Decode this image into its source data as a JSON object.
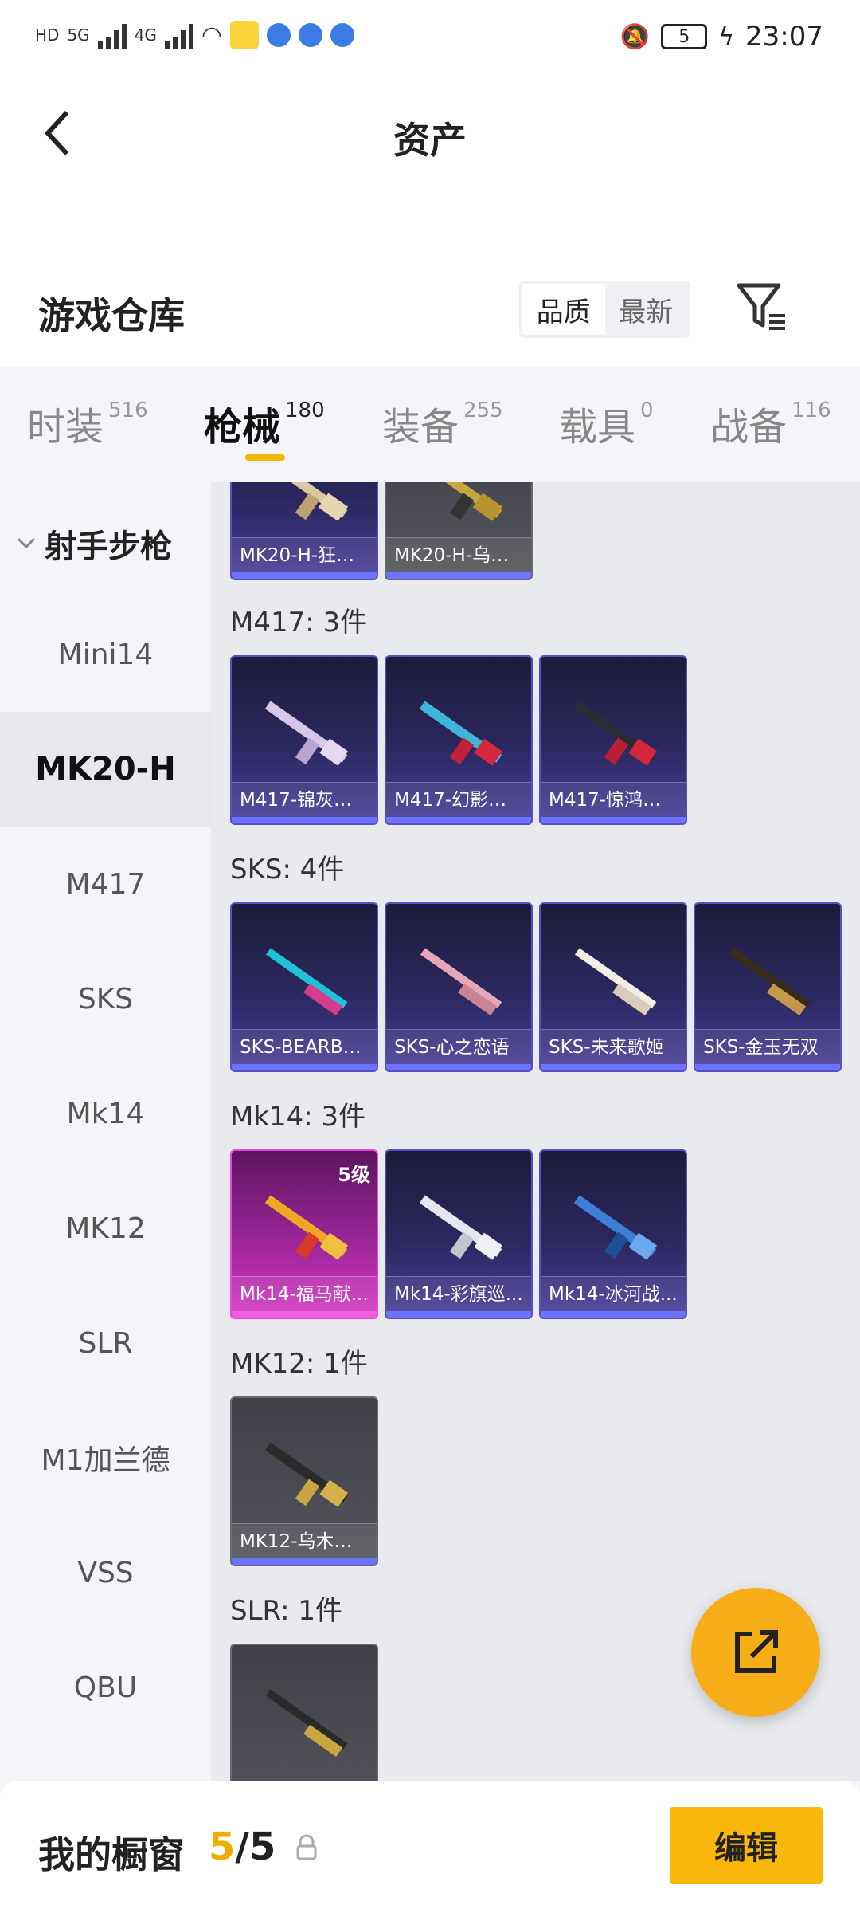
{
  "status_bar": {
    "time": "23:07",
    "battery": "5",
    "left_labels": [
      "HD",
      "5G",
      "4G"
    ]
  },
  "header": {
    "title": "资产"
  },
  "warehouse": {
    "title": "游戏仓库",
    "sort_options": [
      "品质",
      "最新"
    ],
    "active_sort": "品质"
  },
  "tabs": [
    {
      "label": "时装",
      "count": "516"
    },
    {
      "label": "枪械",
      "count": "180"
    },
    {
      "label": "装备",
      "count": "255"
    },
    {
      "label": "载具",
      "count": "0"
    },
    {
      "label": "战备",
      "count": "116"
    }
  ],
  "active_tab": "枪械",
  "sidebar": {
    "group": "射手步枪",
    "items": [
      "Mini14",
      "MK20-H",
      "M417",
      "SKS",
      "Mk14",
      "MK12",
      "SLR",
      "M1加兰德",
      "VSS",
      "QBU"
    ],
    "active_item": "MK20-H"
  },
  "content": {
    "top_partial": [
      "MK20-H-狂鲨...",
      "MK20-H-乌木..."
    ],
    "categories": [
      {
        "title": "M417: 3件",
        "items": [
          "M417-锦灰蝶...",
          "M417-幻影飞...",
          "M417-惊鸿侠..."
        ]
      },
      {
        "title": "SKS: 4件",
        "items": [
          "SKS-BEARBR...",
          "SKS-心之恋语",
          "SKS-未来歌姬",
          "SKS-金玉无双"
        ]
      },
      {
        "title": "Mk14: 3件",
        "items": [
          "Mk14-福马献...",
          "Mk14-彩旗巡...",
          "Mk14-冰河战..."
        ],
        "badge": "5级"
      },
      {
        "title": "MK12: 1件",
        "items": [
          "MK12-乌木金..."
        ]
      },
      {
        "title": "SLR: 1件",
        "items": [
          ""
        ]
      }
    ]
  },
  "bottom_bar": {
    "label": "我的橱窗",
    "current": "5",
    "separator": "/",
    "total": "5",
    "edit_label": "编辑"
  },
  "colors": {
    "accent": "#f5b800",
    "epic_card": "#4a3f9a",
    "legendary_card": "#d53ac6",
    "common_card": "#55555d"
  }
}
